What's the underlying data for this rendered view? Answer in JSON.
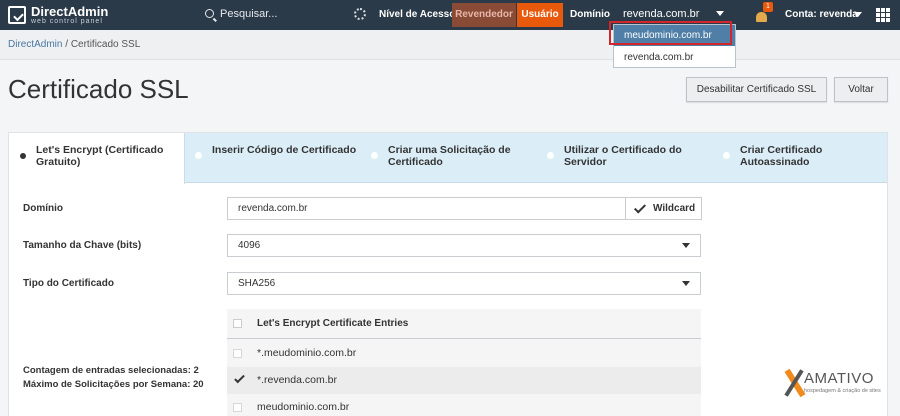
{
  "app": {
    "logo_name": "DirectAdmin",
    "logo_sub": "web control panel"
  },
  "topbar": {
    "search_placeholder": "Pesquisar...",
    "nivel_label": "Nível de Acesso",
    "revendedor_label": "Revendedor",
    "usuario_label": "Usuário",
    "dominio_label": "Domínio",
    "dominio_value": "revenda.com.br",
    "notification_count": "1",
    "conta_label": "Conta: revenda"
  },
  "domain_dropdown": {
    "options": [
      "meudominio.com.br",
      "revenda.com.br"
    ]
  },
  "breadcrumb": {
    "root": "DirectAdmin",
    "separator": " / ",
    "current": "Certificado SSL"
  },
  "page": {
    "title": "Certificado SSL",
    "disable_button": "Desabilitar Certificado SSL",
    "back_button": "Voltar"
  },
  "tabs": [
    {
      "label": "Let's Encrypt (Certificado Gratuito)"
    },
    {
      "label": "Inserir Código de Certificado"
    },
    {
      "label": "Criar uma Solicitação de Certificado"
    },
    {
      "label": "Utilizar o Certificado do Servidor"
    },
    {
      "label": "Criar Certificado Autoassinado"
    }
  ],
  "form": {
    "dominio_label": "Domínio",
    "dominio_value": "revenda.com.br",
    "wildcard_label": "Wildcard",
    "key_size_label": "Tamanho da Chave (bits)",
    "key_size_value": "4096",
    "cert_type_label": "Tipo do Certificado",
    "cert_type_value": "SHA256",
    "entries_header": "Let's Encrypt Certificate Entries",
    "entries": [
      {
        "name": "*.meudominio.com.br",
        "checked": false
      },
      {
        "name": "*.revenda.com.br",
        "checked": true
      },
      {
        "name": "meudominio.com.br",
        "checked": false
      }
    ],
    "selected_count": "Contagem de entradas selecionadas: 2",
    "weekly_max": "Máximo de Solicitações por Semana: 20"
  },
  "watermark": {
    "brand": "AMATIVO",
    "tagline": "hospedagem & criação de sites"
  },
  "colors": {
    "topbar": "#2b3a48",
    "revendedor_bg": "#8a4b36",
    "usuario_bg": "#e8590c",
    "dropdown_highlight": "#4f7ea7",
    "tabs_bg": "#dbeef8",
    "annotation_box": "#d3252c"
  }
}
